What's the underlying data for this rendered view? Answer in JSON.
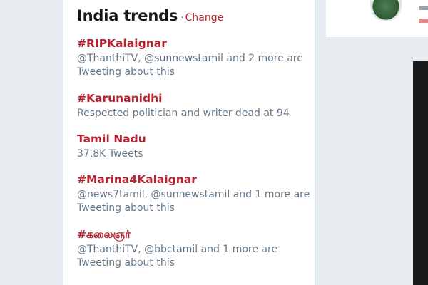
{
  "header": {
    "title": "India trends",
    "separator": "·",
    "change_label": "Change"
  },
  "trends": [
    {
      "name": "#RIPKalaignar",
      "meta": "@ThanthiTV, @sunnewstamil and 2 more are Tweeting about this"
    },
    {
      "name": "#Karunanidhi",
      "meta": "Respected politician and writer dead at 94"
    },
    {
      "name": "Tamil Nadu",
      "meta": "37.8K Tweets"
    },
    {
      "name": "#Marina4Kalaignar",
      "meta": "@news7tamil, @sunnewstamil and 1 more are Tweeting about this"
    },
    {
      "name": "#கலைஞர்",
      "meta": "@ThanthiTV, @bbctamil and 1 more are Tweeting about this"
    }
  ],
  "colors": {
    "accent": "#b8222f",
    "muted_text": "#657786",
    "title_text": "#14171a",
    "page_background": "#e6ecf0"
  }
}
